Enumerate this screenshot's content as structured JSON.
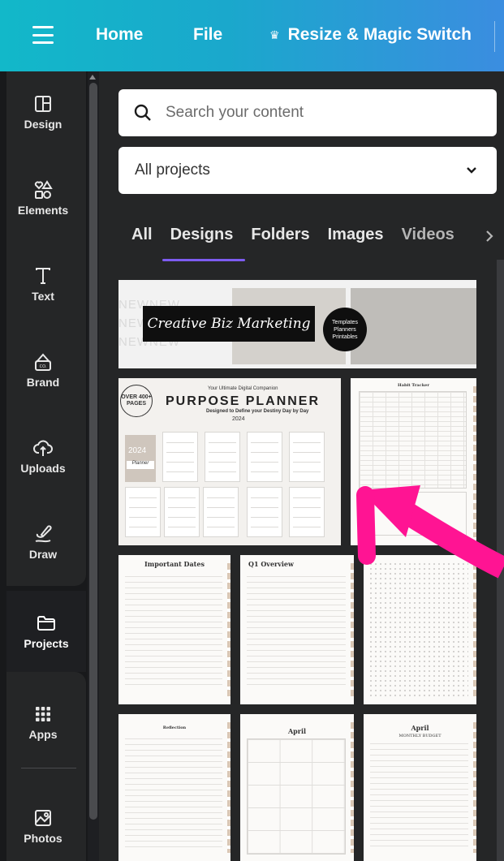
{
  "topbar": {
    "home": "Home",
    "file": "File",
    "resize": "Resize & Magic Switch"
  },
  "sidebar": {
    "items": [
      {
        "label": "Design",
        "icon": "layout-icon"
      },
      {
        "label": "Elements",
        "icon": "shapes-icon"
      },
      {
        "label": "Text",
        "icon": "text-icon"
      },
      {
        "label": "Brand",
        "icon": "brand-icon"
      },
      {
        "label": "Uploads",
        "icon": "cloud-upload-icon"
      },
      {
        "label": "Draw",
        "icon": "pen-icon"
      },
      {
        "label": "Projects",
        "icon": "folder-icon",
        "active": true
      },
      {
        "label": "Apps",
        "icon": "apps-grid-icon"
      },
      {
        "label": "Photos",
        "icon": "image-icon"
      }
    ]
  },
  "panel": {
    "search_placeholder": "Search your content",
    "filter_value": "All projects",
    "tabs": [
      "All",
      "Designs",
      "Folders",
      "Images",
      "Videos"
    ],
    "active_tab": "Designs"
  },
  "thumbnails": {
    "banner": {
      "word": "NEWNEW",
      "script": "Creative Biz Marketing",
      "circle": [
        "Templates",
        "Planners",
        "Printables"
      ]
    },
    "planner": {
      "subtitle": "Your Ultimate Digital Companion",
      "title": "PURPOSE PLANNER",
      "tagline": "Designed to Define your Destiny Day by Day",
      "year": "2024",
      "badge": "OVER 400+ PAGES",
      "cover_year": "2024",
      "cover_word": "Planner"
    },
    "habit_title": "Habit Tracker",
    "important_dates_title": "Important Dates",
    "overview_title": "Q1 Overview",
    "reflection_title": "Reflection",
    "april_title_1": "April",
    "april_title_2": "April",
    "april_sub": "MONTHLY BUDGET"
  },
  "colors": {
    "topbar_start": "#12b8c9",
    "topbar_end": "#3b8de0",
    "tab_underline": "#7d5cf0",
    "arrow": "#ff1493"
  }
}
